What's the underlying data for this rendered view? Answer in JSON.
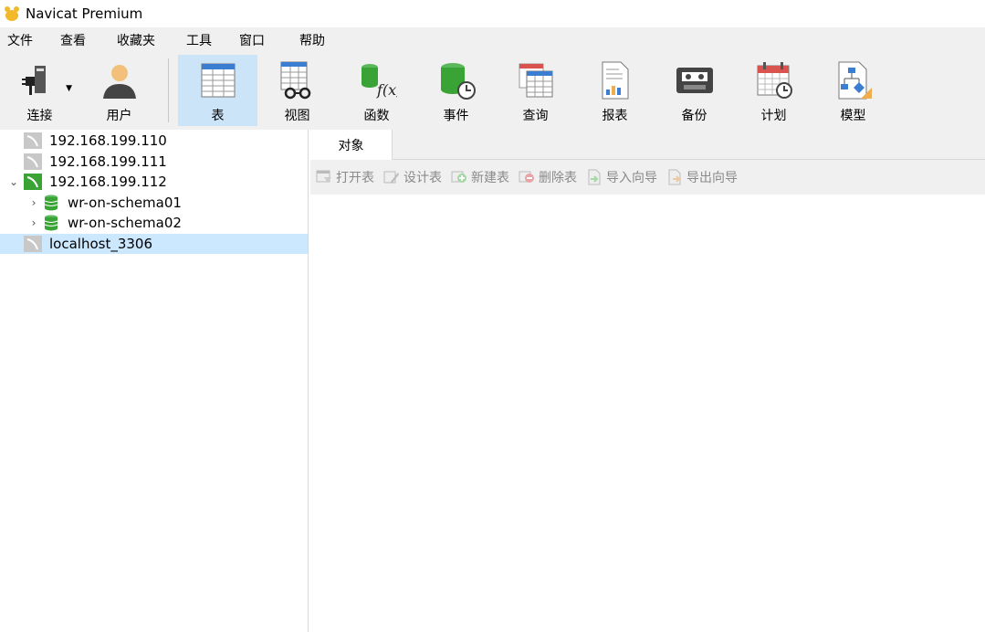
{
  "window": {
    "title": "Navicat Premium"
  },
  "menu": [
    "文件",
    "查看",
    "收藏夹",
    "工具",
    "窗口",
    "帮助"
  ],
  "toolbar": {
    "connect": "连接",
    "user": "用户",
    "table": "表",
    "view": "视图",
    "function": "函数",
    "event": "事件",
    "query": "查询",
    "report": "报表",
    "backup": "备份",
    "schedule": "计划",
    "model": "模型"
  },
  "tree": {
    "conn1": "192.168.199.110",
    "conn2": "192.168.199.111",
    "conn3": "192.168.199.112",
    "db1": "wr-on-schema01",
    "db2": "wr-on-schema02",
    "conn4": "localhost_3306",
    "expanded_chevron": "⌄",
    "collapsed_chevron": "›"
  },
  "tabs": {
    "objects": "对象"
  },
  "object_toolbar": {
    "open_table": "打开表",
    "design_table": "设计表",
    "new_table": "新建表",
    "delete_table": "删除表",
    "import_wizard": "导入向导",
    "export_wizard": "导出向导"
  },
  "colors": {
    "selected": "#cce8ff",
    "active_tool": "#cce4f7",
    "mysql_green": "#3aa336",
    "disabled_text": "#8a8a8a"
  }
}
